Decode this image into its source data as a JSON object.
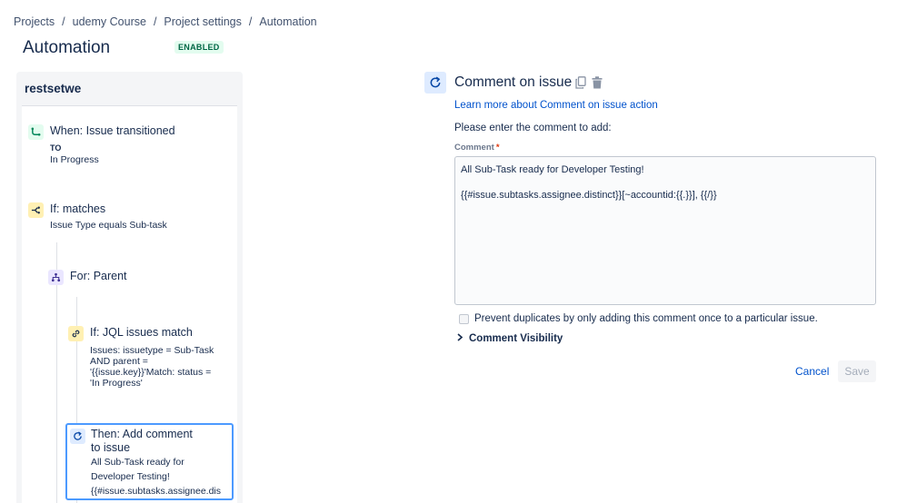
{
  "breadcrumb": {
    "items": [
      "Projects",
      "udemy Course",
      "Project settings",
      "Automation"
    ],
    "separator": "/"
  },
  "header": {
    "title": "Automation",
    "status_badge": "ENABLED"
  },
  "rule": {
    "name": "restsetwe",
    "components": [
      {
        "icon": "transition-icon",
        "title": "When: Issue transitioned",
        "detail_label": "TO",
        "detail": "In Progress"
      },
      {
        "icon": "condition-icon",
        "title": "If: matches",
        "detail": "Issue Type equals Sub-task"
      },
      {
        "icon": "branch-icon",
        "title": "For: Parent"
      },
      {
        "icon": "link-icon",
        "title": "If: JQL issues match",
        "detail_lines": [
          "Issues: issuetype = Sub-Task",
          "AND parent =",
          "'{{issue.key}}'Match: status =",
          "'In Progress'"
        ]
      },
      {
        "icon": "comment-action-icon",
        "title_lines": [
          "Then: Add comment",
          "to issue"
        ],
        "detail_lines": [
          "All Sub-Task ready for",
          "Developer Testing!",
          "{{#issue.subtasks.assignee.dis"
        ]
      }
    ]
  },
  "editor": {
    "title": "Comment on issue",
    "learn_more": "Learn more about Comment on issue action",
    "instruction": "Please enter the comment to add:",
    "comment_label": "Comment",
    "required_mark": "*",
    "comment_value": "All Sub-Task ready for Developer Testing!\n\n{{#issue.subtasks.assignee.distinct}}[~accountid:{{.}}], {{/}}",
    "prevent_duplicates_label": "Prevent duplicates by only adding this comment once to a particular issue.",
    "visibility_label": "Comment Visibility",
    "cancel_label": "Cancel",
    "save_label": "Save"
  },
  "colors": {
    "primary_link": "#0052cc",
    "selected_border": "#4c9aff",
    "badge_bg": "#e3fcef",
    "badge_text": "#006644"
  }
}
